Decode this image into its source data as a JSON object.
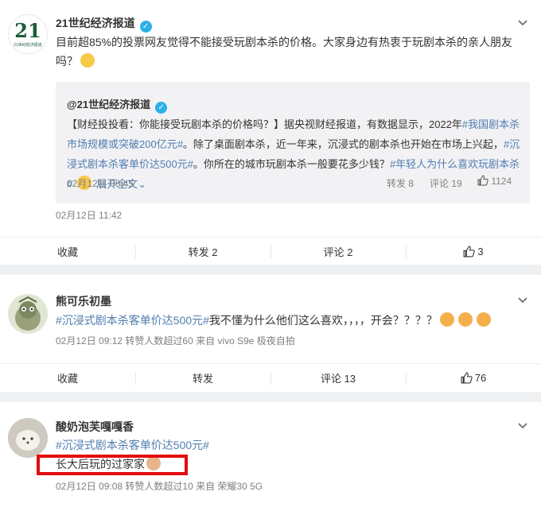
{
  "posts": [
    {
      "author": "21世纪经济报道",
      "logo_text": "21",
      "logo_subtext": "21世纪经济报道",
      "text": "目前超85%的投票网友觉得不能接受玩剧本杀的价格。大家身边有热衷于玩剧本杀的亲人朋友吗？",
      "quote": {
        "author": "@21世纪经济报道",
        "text_a": "【财经投投看：你能接受玩剧本杀的价格吗？】据央视财经报道，有数据显示，2022年",
        "topic1": "#我国剧本杀市场规模或突破200亿元#",
        "text_b": "。除了桌面剧本杀，近一年来，沉浸式的剧本杀也开始在市场上兴起，",
        "topic2": "#沉浸式剧本杀客单价达500元#",
        "text_c": "。你所在的城市玩剧本杀一般要花多少钱？",
        "topic3": "#年轻人为什么喜欢玩剧本杀#",
        "expand": "展开全文",
        "time": "02月12日 08:45",
        "repost": "转发 8",
        "comment": "评论 19",
        "like": "1124"
      },
      "time": "02月12日 11:42",
      "actions": {
        "fav": "收藏",
        "repost": "转发 2",
        "comment": "评论 2",
        "like": "3"
      }
    },
    {
      "author": "熊可乐初墨",
      "topic": "#沉浸式剧本杀客单价达500元#",
      "text": "我不懂为什么他们这么喜欢，，，，开会？？？？",
      "meta": "02月12日 09:12 转赞人数超过60  来自 vivo S9e 极夜自拍",
      "actions": {
        "fav": "收藏",
        "repost": "转发",
        "comment": "评论 13",
        "like": "76"
      }
    },
    {
      "author": "酸奶泡芙嘎嘎香",
      "topic": "#沉浸式剧本杀客单价达500元#",
      "text": "长大后玩的过家家",
      "meta": "02月12日 09:08 转赞人数超过10  来自 荣耀30 5G"
    }
  ],
  "colors": {
    "topic": "#eb7350",
    "highlight_box": "#e40c0c",
    "verified": "#2bb0e8"
  }
}
